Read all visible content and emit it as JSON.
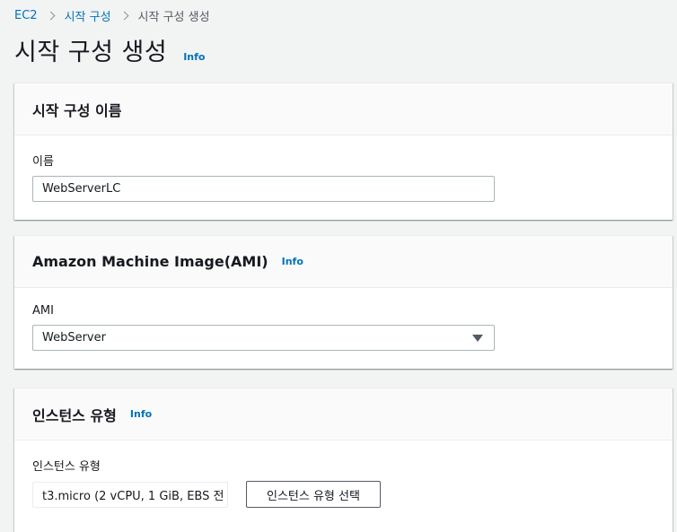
{
  "breadcrumb": {
    "items": [
      "EC2",
      "시작 구성",
      "시작 구성 생성"
    ]
  },
  "page": {
    "title": "시작 구성 생성",
    "info": "Info"
  },
  "sections": {
    "name": {
      "title": "시작 구성 이름",
      "field_label": "이름",
      "value": "WebServerLC"
    },
    "ami": {
      "title": "Amazon Machine Image(AMI)",
      "info": "Info",
      "field_label": "AMI",
      "selected": "WebServer"
    },
    "instance_type": {
      "title": "인스턴스 유형",
      "info": "Info",
      "field_label": "인스턴스 유형",
      "value": "t3.micro (2 vCPU, 1 GiB, EBS 전",
      "button_label": "인스턴스 유형 선택"
    }
  }
}
